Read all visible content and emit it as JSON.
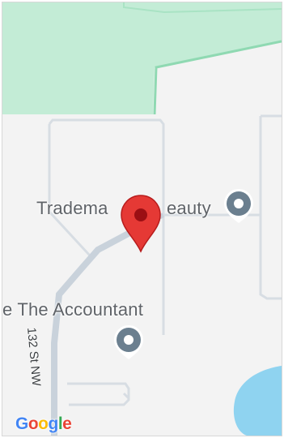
{
  "map": {
    "colors": {
      "land": "#f3f3f3",
      "park": "#c3ecd6",
      "park_border": "#8fd9b2",
      "road_minor": "#d7dde3",
      "road_path": "#c9d2db",
      "water": "#8fd3f0",
      "poi": "#6b7f8f",
      "marker": "#e53935",
      "marker_dot": "#9b0f14"
    },
    "labels": {
      "place_1": "Tradema",
      "place_1_tail": "eauty",
      "place_2": "e The Accountant",
      "street_1": "132 St NW"
    },
    "logo": {
      "letters": [
        "G",
        "o",
        "o",
        "g",
        "l",
        "e"
      ],
      "colors": [
        "#4285F4",
        "#EA4335",
        "#FBBC05",
        "#4285F4",
        "#34A853",
        "#EA4335"
      ]
    },
    "icons": {
      "selected_marker": "map-pin-icon",
      "poi_1": "poi-icon",
      "poi_2": "poi-icon"
    }
  }
}
